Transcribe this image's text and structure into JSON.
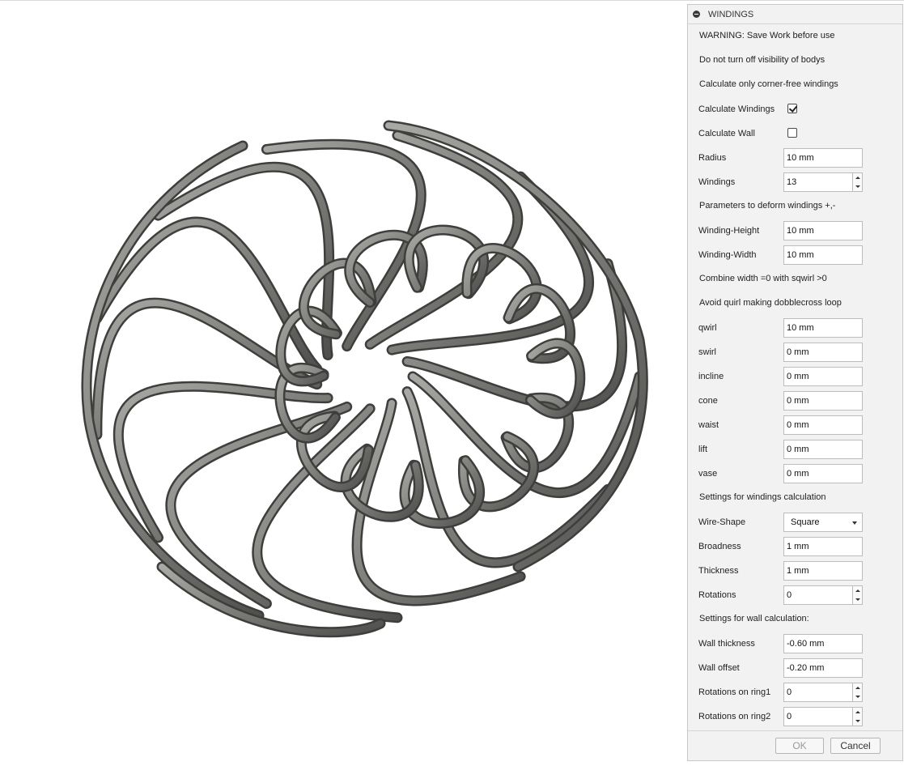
{
  "dialog": {
    "title": "WINDINGS",
    "warning": "WARNING: Save Work before use",
    "visibility_note": "Do not turn off visibility of bodys",
    "corner_note": "Calculate only corner-free windings",
    "calc_windings": {
      "label": "Calculate Windings",
      "checked": true
    },
    "calc_wall": {
      "label": "Calculate Wall",
      "checked": false
    },
    "radius": {
      "label": "Radius",
      "value": "10 mm"
    },
    "windings": {
      "label": "Windings",
      "value": "13"
    },
    "deform_note": "Parameters to deform windings +,-",
    "winding_height": {
      "label": "Winding-Height",
      "value": "10 mm"
    },
    "winding_width": {
      "label": "Winding-Width",
      "value": "10 mm"
    },
    "combine_note": "Combine width =0 with sqwirl >0",
    "avoid_note": "Avoid quirl making dobblecross loop",
    "qwirl": {
      "label": "qwirl",
      "value": "10 mm"
    },
    "swirl": {
      "label": "swirl",
      "value": "0 mm"
    },
    "incline": {
      "label": "incline",
      "value": "0 mm"
    },
    "cone": {
      "label": "cone",
      "value": "0 mm"
    },
    "waist": {
      "label": "waist",
      "value": "0 mm"
    },
    "lift": {
      "label": "lift",
      "value": "0 mm"
    },
    "vase": {
      "label": "vase",
      "value": "0 mm"
    },
    "calc_settings_note": "Settings for windings calculation",
    "wire_shape": {
      "label": "Wire-Shape",
      "value": "Square"
    },
    "broadness": {
      "label": "Broadness",
      "value": "1 mm"
    },
    "thickness": {
      "label": "Thickness",
      "value": "1 mm"
    },
    "rotations": {
      "label": "Rotations",
      "value": "0"
    },
    "wall_settings_note": "Settings for wall calculation:",
    "wall_thickness": {
      "label": "Wall thickness",
      "value": "-0.60 mm"
    },
    "wall_offset": {
      "label": "Wall offset",
      "value": "-0.20 mm"
    },
    "rotations_ring1": {
      "label": "Rotations on ring1",
      "value": "0"
    },
    "rotations_ring2": {
      "label": "Rotations on ring2",
      "value": "0"
    },
    "ok_label": "OK",
    "cancel_label": "Cancel"
  },
  "model": {
    "name": "wire-windings-model",
    "wire_color": "#7b7b79",
    "windings_count": 13
  },
  "colors": {
    "panel_bg": "#f2f2f2",
    "panel_border": "#c8c8c8",
    "field_border": "#bdbdbd"
  }
}
